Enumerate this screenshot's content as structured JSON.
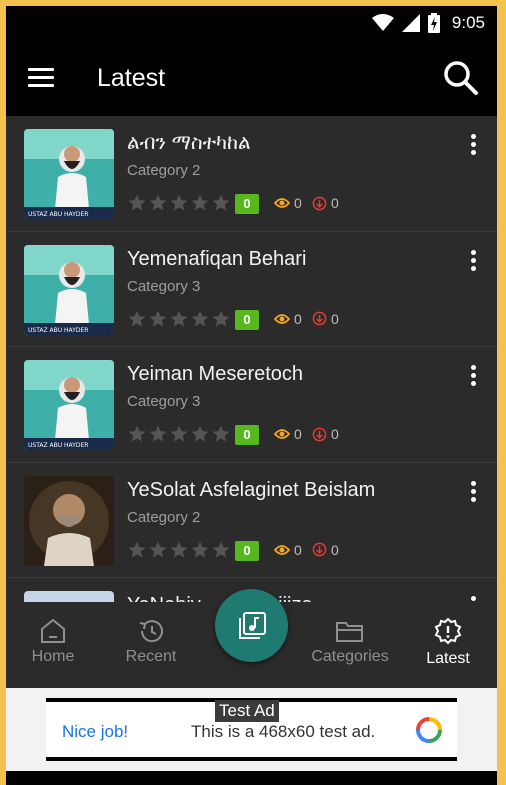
{
  "status_bar": {
    "time": "9:05"
  },
  "app_bar": {
    "title": "Latest"
  },
  "items": [
    {
      "title": "ልብን ማስተካከል",
      "category": "Category 2",
      "rating": "0",
      "views": "0",
      "downloads": "0",
      "thumb_caption": "USTAZ ABU HAYDER"
    },
    {
      "title": "Yemenafiqan Behari",
      "category": "Category 3",
      "rating": "0",
      "views": "0",
      "downloads": "0",
      "thumb_caption": "USTAZ ABU HAYDER"
    },
    {
      "title": "Yeiman Meseretoch",
      "category": "Category 3",
      "rating": "0",
      "views": "0",
      "downloads": "0",
      "thumb_caption": "USTAZ ABU HAYDER"
    },
    {
      "title": "YeSolat Asfelaginet Beislam",
      "category": "Category 2",
      "rating": "0",
      "views": "0",
      "downloads": "0",
      "thumb_caption": ""
    },
    {
      "title": "YeNebiy... ...` Mujiiza",
      "category": "",
      "rating": "",
      "views": "",
      "downloads": "",
      "thumb_caption": ""
    }
  ],
  "bottom_nav": {
    "items": [
      {
        "label": "Home"
      },
      {
        "label": "Recent"
      },
      {
        "label": "Categories"
      },
      {
        "label": "Latest"
      }
    ]
  },
  "ad": {
    "label": "Test Ad",
    "nice": "Nice job!",
    "text": "This is a 468x60 test ad."
  },
  "colors": {
    "frame": "#f2c14e",
    "background": "#2b2b2b",
    "rating_badge": "#56b81c",
    "views_icon": "#f5a623",
    "downloads_icon": "#e53935",
    "fab": "#1f7a72"
  }
}
